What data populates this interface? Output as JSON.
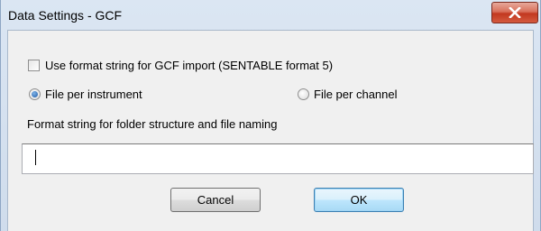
{
  "window": {
    "title": "Data Settings - GCF",
    "close_glyph": "X"
  },
  "options": {
    "use_format_string": {
      "label": "Use format string for GCF import (SENTABLE format 5)",
      "checked": false
    },
    "mode": {
      "file_per_instrument": {
        "label": "File per instrument",
        "selected": true
      },
      "file_per_channel": {
        "label": "File per channel",
        "selected": false
      }
    }
  },
  "format_string": {
    "label": "Format string for folder structure and file naming",
    "value": ""
  },
  "buttons": {
    "cancel_label": "Cancel",
    "ok_label": "OK"
  },
  "icons": {
    "close": "close-icon"
  }
}
